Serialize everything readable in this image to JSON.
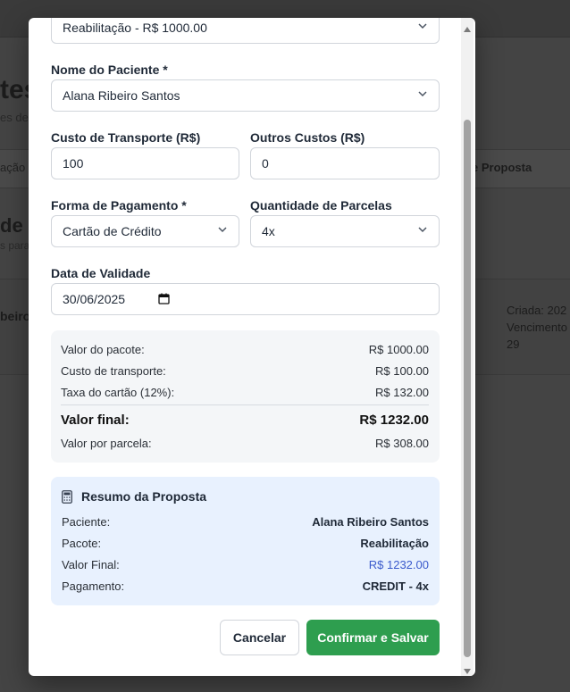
{
  "background": {
    "title_fragment": "tes",
    "subtitle_fragment": "es de",
    "band_left_fragment": "ação",
    "band_right_fragment": "e Proposta",
    "heading_fragment": "de",
    "heading_sub_fragment": "s para",
    "row_left_fragment": "beiro",
    "row_right_lines": [
      "Criada: 202",
      "Vencimento",
      "29"
    ]
  },
  "form": {
    "package_select_value": "Reabilitação - R$ 1000.00",
    "patient_label": "Nome do Paciente *",
    "patient_value": "Alana Ribeiro Santos",
    "transport_label": "Custo de Transporte (R$)",
    "transport_value": "100",
    "other_costs_label": "Outros Custos (R$)",
    "other_costs_value": "0",
    "payment_label": "Forma de Pagamento *",
    "payment_value": "Cartão de Crédito",
    "installments_label": "Quantidade de Parcelas",
    "installments_value": "4x",
    "validity_label": "Data de Validade",
    "validity_value": "30/06/2025"
  },
  "summary": {
    "package_label": "Valor do pacote:",
    "package_value": "R$ 1000.00",
    "transport_label": "Custo de transporte:",
    "transport_value": "R$ 100.00",
    "card_fee_label": "Taxa do cartão (12%):",
    "card_fee_value": "R$ 132.00",
    "final_label": "Valor final:",
    "final_value": "R$ 1232.00",
    "per_installment_label": "Valor por parcela:",
    "per_installment_value": "R$ 308.00"
  },
  "resume": {
    "title": "Resumo da Proposta",
    "patient_label": "Paciente:",
    "patient_value": "Alana Ribeiro Santos",
    "package_label": "Pacote:",
    "package_value": "Reabilitação",
    "final_label": "Valor Final:",
    "final_value": "R$ 1232.00",
    "payment_label": "Pagamento:",
    "payment_value": "CREDIT - 4x"
  },
  "actions": {
    "cancel_label": "Cancelar",
    "confirm_label": "Confirmar e Salvar"
  },
  "colors": {
    "confirm_button": "#2e9e4f",
    "final_value_blue": "#3b5bcc",
    "resume_background": "#e8f1fe"
  }
}
